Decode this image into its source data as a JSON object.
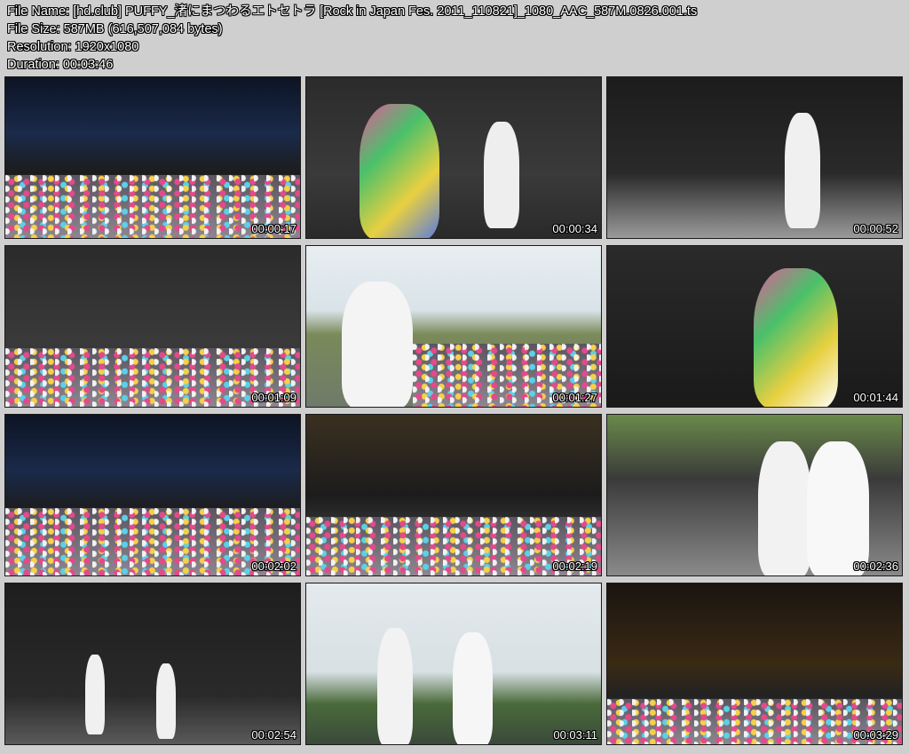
{
  "info": {
    "file_name": "File Name: [hd.club] PUFFY_渚にまつわるエトセトラ [Rock in Japan Fes. 2011_110821]_1080_AAC_587M.0826.001.ts",
    "file_size": "File Size: 587MB (616,507,084 bytes)",
    "resolution": "Resolution: 1920x1080",
    "duration": "Duration: 00:03:46"
  },
  "thumbnails": [
    {
      "time": "00:00:17",
      "scene": "stage-dark"
    },
    {
      "time": "00:00:34",
      "scene": "stage-day"
    },
    {
      "time": "00:00:52",
      "scene": "stage-day"
    },
    {
      "time": "00:01:09",
      "scene": "stage-day"
    },
    {
      "time": "00:01:27",
      "scene": "sky"
    },
    {
      "time": "00:01:44",
      "scene": "stage-day"
    },
    {
      "time": "00:02:02",
      "scene": "stage-dark"
    },
    {
      "time": "00:02:19",
      "scene": "stage-dark"
    },
    {
      "time": "00:02:36",
      "scene": "sky"
    },
    {
      "time": "00:02:54",
      "scene": "stage-day"
    },
    {
      "time": "00:03:11",
      "scene": "sky"
    },
    {
      "time": "00:03:29",
      "scene": "stage-dark"
    }
  ]
}
